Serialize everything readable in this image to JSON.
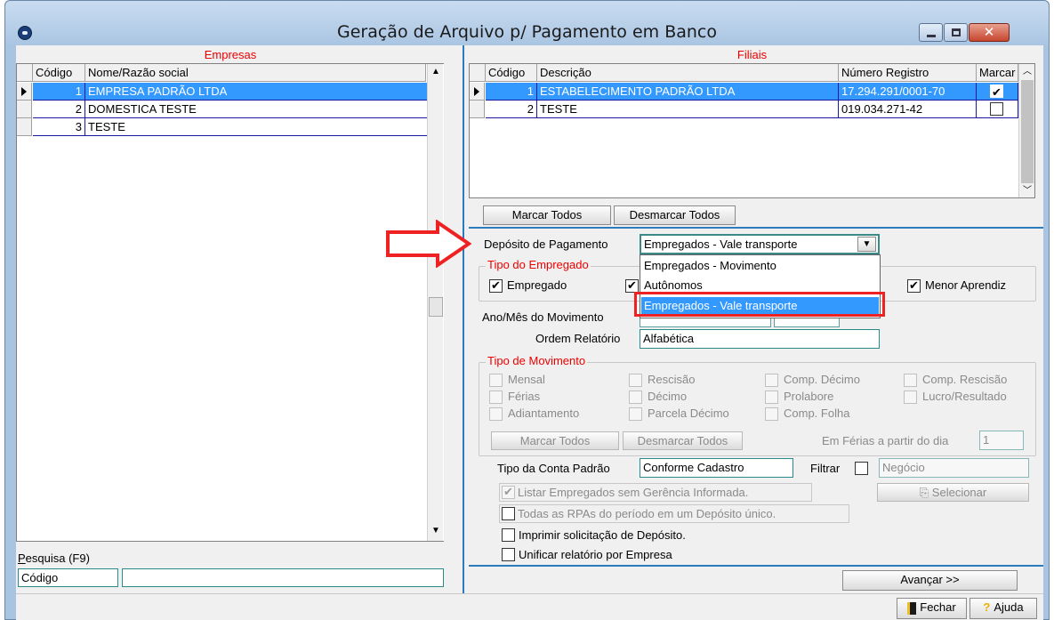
{
  "window": {
    "title": "Geração de Arquivo p/ Pagamento em Banco"
  },
  "empresas": {
    "title": "Empresas",
    "columns": [
      "Código",
      "Nome/Razão social"
    ],
    "rows": [
      {
        "codigo": "1",
        "nome": "EMPRESA PADRÃO LTDA",
        "selected": true
      },
      {
        "codigo": "2",
        "nome": "DOMESTICA TESTE",
        "selected": false
      },
      {
        "codigo": "3",
        "nome": "TESTE",
        "selected": false
      }
    ],
    "search_label": "Pesquisa (F9)",
    "search_field": "Código",
    "search_value": ""
  },
  "filiais": {
    "title": "Filiais",
    "columns": [
      "Código",
      "Descrição",
      "Número Registro",
      "Marcar"
    ],
    "rows": [
      {
        "codigo": "1",
        "descricao": "ESTABELECIMENTO PADRÃO LTDA",
        "registro": "17.294.291/0001-70",
        "marcar": true,
        "selected": true
      },
      {
        "codigo": "2",
        "descricao": "TESTE",
        "registro": "019.034.271-42",
        "marcar": false,
        "selected": false
      }
    ],
    "btn_marcar": "Marcar Todos",
    "btn_desmarcar": "Desmarcar Todos"
  },
  "deposito": {
    "label": "Depósito de Pagamento",
    "value": "Empregados - Vale transporte",
    "options": [
      "Empregados - Movimento",
      "Autônomos",
      "Empregados - Vale transporte"
    ],
    "highlighted_index": 2
  },
  "tipo_empregado": {
    "title": "Tipo do Empregado",
    "empregado": {
      "label": "Empregado",
      "checked": true
    },
    "menor_aprendiz": {
      "label": "Menor Aprendiz",
      "checked": true
    }
  },
  "ano_mes_label": "Ano/Mês do Movimento",
  "ordem": {
    "label": "Ordem Relatório",
    "value": "Alfabética"
  },
  "tipo_movimento": {
    "title": "Tipo de Movimento",
    "items": [
      {
        "label": "Mensal"
      },
      {
        "label": "Rescisão"
      },
      {
        "label": "Comp. Décimo"
      },
      {
        "label": "Comp. Rescisão"
      },
      {
        "label": "Férias"
      },
      {
        "label": "Décimo"
      },
      {
        "label": "Prolabore"
      },
      {
        "label": "Lucro/Resultado"
      },
      {
        "label": "Adiantamento"
      },
      {
        "label": "Parcela Décimo"
      },
      {
        "label": "Comp. Folha"
      }
    ],
    "btn_marcar": "Marcar Todos",
    "btn_desmarcar": "Desmarcar Todos",
    "ferias_label": "Em Férias a partir do dia",
    "ferias_value": "1"
  },
  "conta": {
    "label": "Tipo da Conta Padrão",
    "value": "Conforme Cadastro",
    "filtrar_label": "Filtrar",
    "filtrar_placeholder": "Negócio",
    "selecionar": "Selecionar"
  },
  "options": {
    "listar": "Listar Empregados sem Gerência Informada.",
    "todas_rpas": "Todas as RPAs do período em um Depósito único.",
    "imprimir": "Imprimir solicitação de Depósito.",
    "unificar": "Unificar relatório por Empresa"
  },
  "footer": {
    "avancar": "Avançar >>",
    "fechar": "Fechar",
    "ajuda": "Ajuda"
  },
  "colors": {
    "selection": "#3399ff",
    "title_red": "#e00000",
    "arrow_red": "#e22222"
  }
}
